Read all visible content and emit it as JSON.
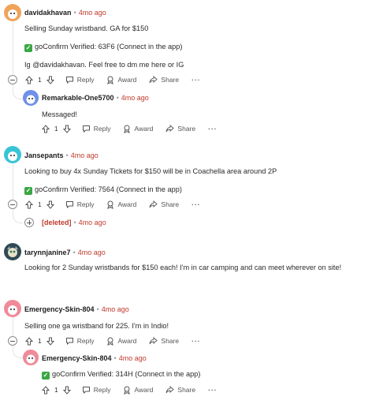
{
  "comments": [
    {
      "username": "davidakhavan",
      "time": "4mo ago",
      "lines": [
        "Selling Sunday wristband. GA for $150",
        "goConfirm Verified: 63F6 (Connect in the app)",
        "Ig @davidakhavan. Feel free to dm me here or IG"
      ],
      "votes": "1",
      "avatar_color": "#f0a35a"
    },
    {
      "username": "Remarkable-One5700",
      "time": "4mo ago",
      "lines": [
        "Messaged!"
      ],
      "votes": "1",
      "avatar_color": "#6f8fe8"
    },
    {
      "username": "Jansepants",
      "time": "4mo ago",
      "lines": [
        "Looking to buy 4x Sunday Tickets for $150 will be in Coachella area around 2P",
        "goConfirm Verified: 7564 (Connect in the app)"
      ],
      "votes": "1",
      "avatar_color": "#38c4d6"
    },
    {
      "username": "[deleted]",
      "time": "4mo ago"
    },
    {
      "username": "tarynnjanine7",
      "time": "4mo ago",
      "lines": [
        "Looking for 2 Sunday wristbands for $150 each! I'm in car camping and can meet wherever on site!"
      ],
      "avatar_color": "#2f4a55"
    },
    {
      "username": "Emergency-Skin-804",
      "time": "4mo ago",
      "lines": [
        "Selling one ga wristband for 225. I'm in Indio!"
      ],
      "votes": "1",
      "avatar_color": "#f08a98"
    },
    {
      "username": "Emergency-Skin-804",
      "time": "4mo ago",
      "lines": [
        "goConfirm Verified: 314H (Connect in the app)"
      ],
      "votes": "1",
      "avatar_color": "#f08a98"
    }
  ],
  "actions": {
    "reply": "Reply",
    "award": "Award",
    "share": "Share",
    "more": "···"
  },
  "dot": "•"
}
